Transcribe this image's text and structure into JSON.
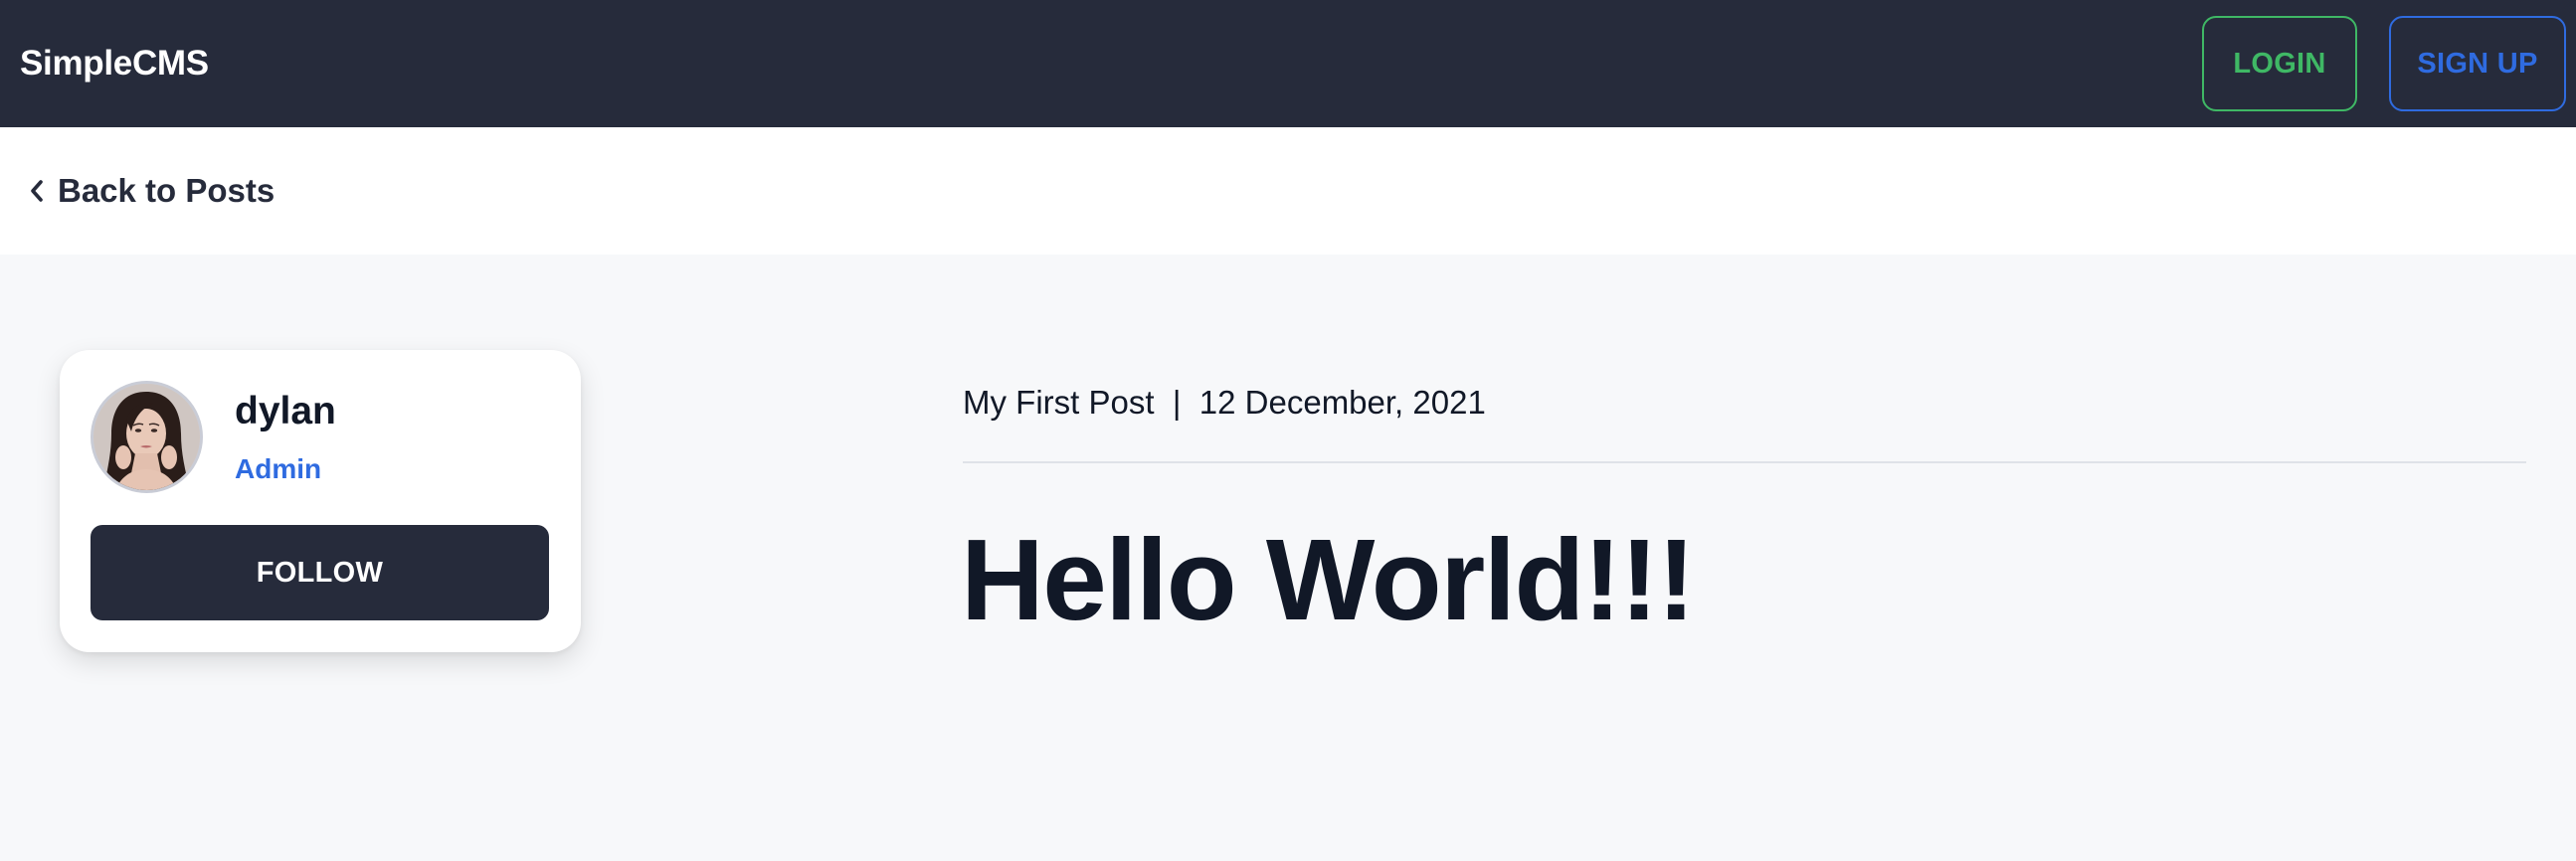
{
  "navbar": {
    "brand": "SimpleCMS",
    "login_label": "LOGIN",
    "signup_label": "SIGN UP",
    "colors": {
      "background": "#262b3b",
      "login": "#3fb865",
      "signup": "#2f6be0"
    }
  },
  "backbar": {
    "back_label": "Back to Posts",
    "icon": "chevron-left-icon"
  },
  "author": {
    "name": "dylan",
    "role": "Admin",
    "follow_label": "FOLLOW",
    "role_color": "#2f6be0"
  },
  "post": {
    "category": "My First Post",
    "separator": "|",
    "date": "12 December, 2021",
    "title": "Hello World!!!"
  }
}
